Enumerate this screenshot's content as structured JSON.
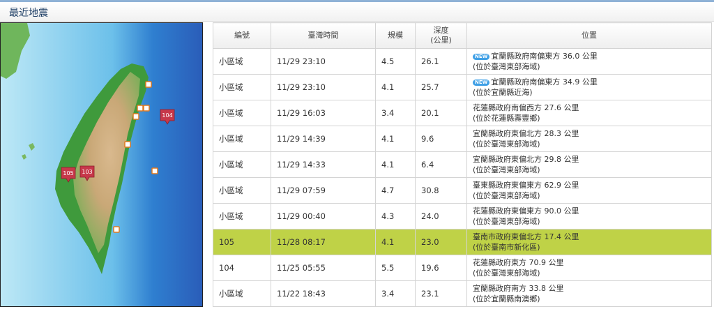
{
  "header": {
    "title": "最近地震"
  },
  "map": {
    "markers": [
      {
        "label": "104",
        "style": "pin"
      },
      {
        "label": "105",
        "style": "pin"
      },
      {
        "label": "103",
        "style": "pin"
      }
    ]
  },
  "table": {
    "columns": [
      "編號",
      "臺灣時間",
      "規模",
      "深度\n(公里)",
      "位置"
    ],
    "rows": [
      {
        "id": "小區域",
        "time": "11/29 23:10",
        "mag": "4.5",
        "depth": "26.1",
        "new": true,
        "loc1": "宜蘭縣政府南偏東方 36.0 公里",
        "loc2": "(位於臺灣東部海域)"
      },
      {
        "id": "小區域",
        "time": "11/29 23:10",
        "mag": "4.1",
        "depth": "25.7",
        "new": true,
        "loc1": "宜蘭縣政府南偏東方 34.9 公里",
        "loc2": "(位於宜蘭縣近海)"
      },
      {
        "id": "小區域",
        "time": "11/29 16:03",
        "mag": "3.4",
        "depth": "20.1",
        "new": false,
        "loc1": "花蓮縣政府南偏西方 27.6 公里",
        "loc2": "(位於花蓮縣壽豐鄉)"
      },
      {
        "id": "小區域",
        "time": "11/29 14:39",
        "mag": "4.1",
        "depth": "9.6",
        "new": false,
        "loc1": "宜蘭縣政府東偏北方 28.3 公里",
        "loc2": "(位於臺灣東部海域)"
      },
      {
        "id": "小區域",
        "time": "11/29 14:33",
        "mag": "4.1",
        "depth": "6.4",
        "new": false,
        "loc1": "宜蘭縣政府東偏北方 29.8 公里",
        "loc2": "(位於臺灣東部海域)"
      },
      {
        "id": "小區域",
        "time": "11/29 07:59",
        "mag": "4.7",
        "depth": "30.8",
        "new": false,
        "loc1": "臺東縣政府東偏東方 62.9 公里",
        "loc2": "(位於臺灣東部海域)"
      },
      {
        "id": "小區域",
        "time": "11/29 00:40",
        "mag": "4.3",
        "depth": "24.0",
        "new": false,
        "loc1": "花蓮縣政府東偏東方 90.0 公里",
        "loc2": "(位於臺灣東部海域)"
      },
      {
        "id": "105",
        "time": "11/28 08:17",
        "mag": "4.1",
        "depth": "23.0",
        "new": false,
        "loc1": "臺南市政府東偏北方 17.4 公里",
        "loc2": "(位於臺南市新化區)",
        "highlight": true
      },
      {
        "id": "104",
        "time": "11/25 05:55",
        "mag": "5.5",
        "depth": "19.6",
        "new": false,
        "loc1": "花蓮縣政府東方 70.9 公里",
        "loc2": "(位於臺灣東部海域)"
      },
      {
        "id": "小區域",
        "time": "11/22 18:43",
        "mag": "3.4",
        "depth": "23.1",
        "new": false,
        "loc1": "宜蘭縣政府南方 33.8 公里",
        "loc2": "(位於宜蘭縣南澳鄉)"
      }
    ],
    "new_badge": "NEW"
  },
  "colors": {
    "highlight": "#bfd247",
    "ocean": "#2f74c8",
    "header_text": "#1f3f66"
  }
}
